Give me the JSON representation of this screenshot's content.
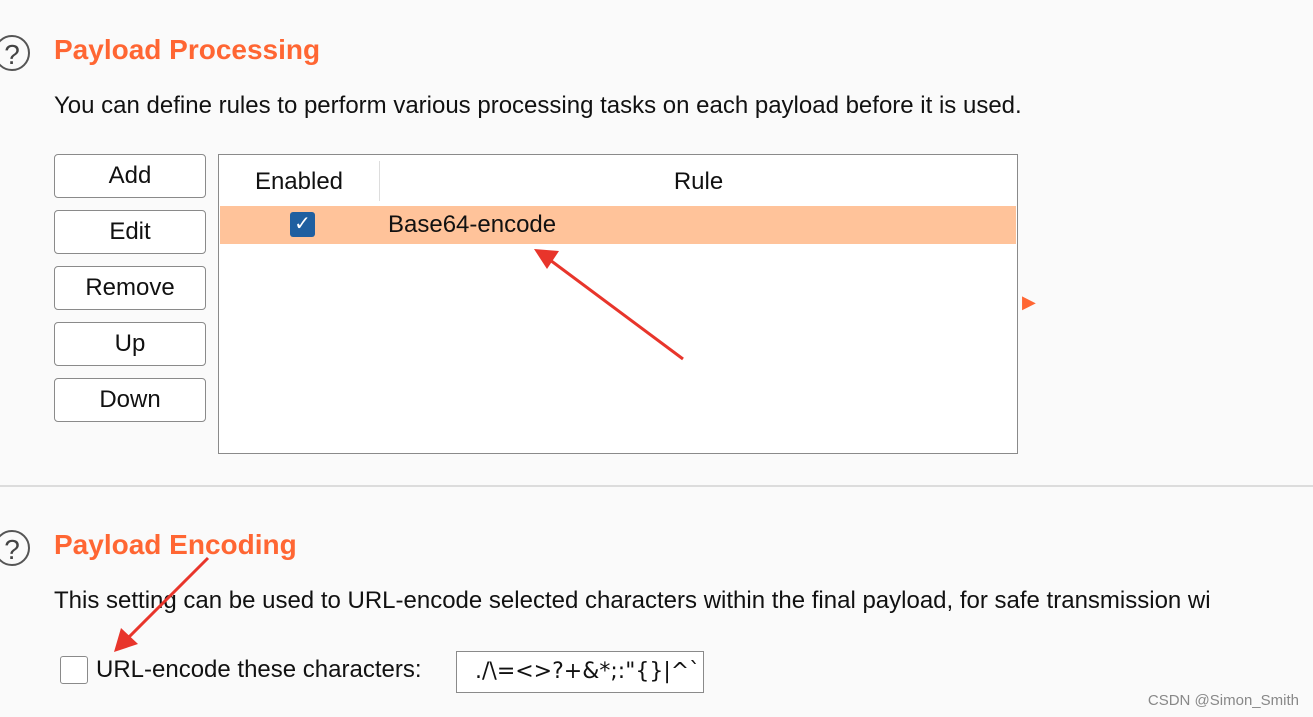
{
  "processing": {
    "title": "Payload Processing",
    "description": "You can define rules to perform various processing tasks on each payload before it is used.",
    "help_icon": "?",
    "buttons": [
      "Add",
      "Edit",
      "Remove",
      "Up",
      "Down"
    ],
    "table": {
      "columns": [
        "Enabled",
        "Rule"
      ],
      "rows": [
        {
          "enabled": true,
          "rule": "Base64-encode"
        }
      ]
    },
    "expand_icon": "▶"
  },
  "encoding": {
    "title": "Payload Encoding",
    "description": "This setting can be used to URL-encode selected characters within the final payload, for safe transmission wi",
    "help_icon": "?",
    "checkbox_label": "URL-encode these characters:",
    "checkbox_checked": false,
    "characters_value": "./\\=<>?+&*;:\"{}|^`"
  },
  "watermark": "CSDN @Simon_Smith",
  "colors": {
    "accent": "#ff6633",
    "selected_row": "#ffc39a",
    "checkbox": "#1f5fa0",
    "annotation_arrow": "#e8352b"
  }
}
